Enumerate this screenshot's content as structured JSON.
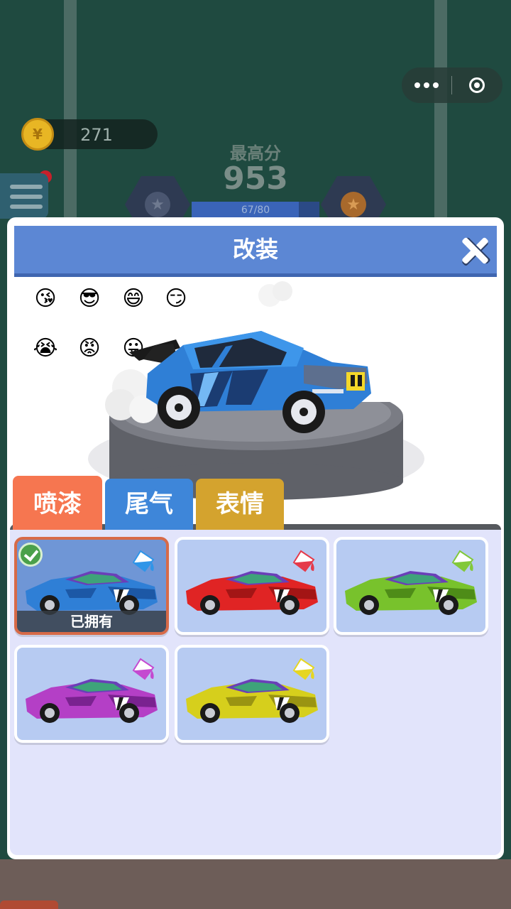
{
  "hud": {
    "coins": "271",
    "coin_symbol": "¥",
    "best_label": "最高分",
    "best_score": "953",
    "progress_text": "67/80",
    "progress_fraction": 0.8375
  },
  "modal": {
    "title": "改装",
    "emojis": [
      "😘",
      "😎",
      "😄",
      "😏",
      "😭",
      "😡",
      "😛"
    ],
    "tabs": [
      {
        "label": "喷漆",
        "active": true
      },
      {
        "label": "尾气",
        "active": false
      },
      {
        "label": "表情",
        "active": false
      }
    ],
    "paints": [
      {
        "color": "#2f7fd6",
        "dark": "#1c58a6",
        "selected": true,
        "owned": true,
        "owned_label": "已拥有"
      },
      {
        "color": "#e02424",
        "dark": "#a31515",
        "selected": false,
        "owned": false
      },
      {
        "color": "#78c22c",
        "dark": "#4e8c18",
        "selected": false,
        "owned": false
      },
      {
        "color": "#b43fc6",
        "dark": "#7a2290",
        "selected": false,
        "owned": false
      },
      {
        "color": "#d6cf1c",
        "dark": "#9a9412",
        "selected": false,
        "owned": false
      }
    ],
    "bucket_colors": [
      "#2f95e8",
      "#e53a4a",
      "#82c83a",
      "#c44ad0",
      "#e6d622"
    ]
  },
  "colors": {
    "header": "#5c87d4",
    "tab_spray": "#f67650",
    "tab_exhaust": "#3e86d9",
    "tab_emoji": "#d4a32e",
    "panel": "#e2e4fb",
    "card": "#b7cbf2"
  }
}
